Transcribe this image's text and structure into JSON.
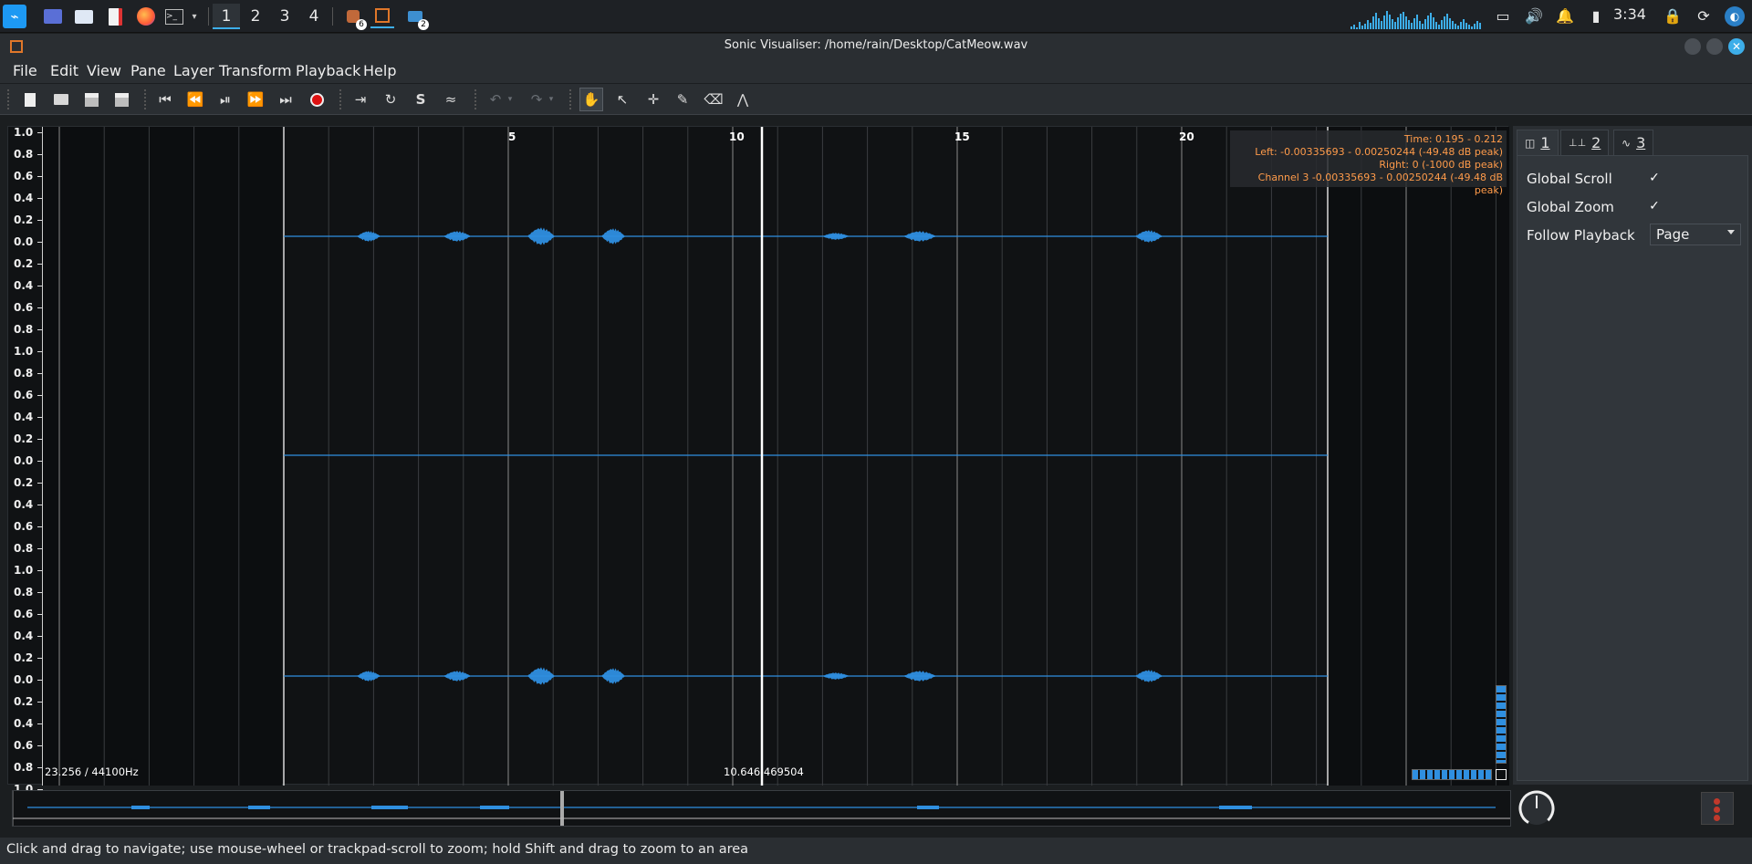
{
  "taskbar": {
    "virtual_desktops": [
      "1",
      "2",
      "3",
      "4"
    ],
    "badges": {
      "app1": "6",
      "app3": "2"
    },
    "clock": "3:34"
  },
  "window": {
    "title": "Sonic Visualiser: /home/rain/Desktop/CatMeow.wav"
  },
  "menu": [
    "File",
    "Edit",
    "View",
    "Pane",
    "Layer",
    "Transform",
    "Playback",
    "Help"
  ],
  "toolbar": {
    "icons": [
      "new-icon",
      "open-icon",
      "save-icon",
      "save-as-icon",
      "rewind-start-icon",
      "rewind-icon",
      "play-pause-icon",
      "fast-forward-icon",
      "fast-forward-end-icon",
      "record-icon",
      "play-selection-icon",
      "loop-icon",
      "solo-icon",
      "speed-icon",
      "undo-icon",
      "redo-icon",
      "navigate-icon",
      "select-icon",
      "edit-icon",
      "draw-icon",
      "erase-icon",
      "measure-icon"
    ]
  },
  "pane": {
    "scale_labels": [
      "1.0",
      "0.8",
      "0.6",
      "0.4",
      "0.2",
      "0.0",
      "0.2",
      "0.4",
      "0.6",
      "0.8",
      "1.0",
      "0.8",
      "0.6",
      "0.4",
      "0.2",
      "0.0",
      "0.2",
      "0.4",
      "0.6",
      "0.8",
      "1.0",
      "0.8",
      "0.6",
      "0.4",
      "0.2",
      "0.0",
      "0.2",
      "0.4",
      "0.6",
      "0.8",
      "1.0"
    ],
    "time_ruler": [
      "5",
      "10",
      "15",
      "20"
    ],
    "info": {
      "time": "Time: 0.195 - 0.212",
      "left": "Left: -0.00335693 - 0.00250244 (-49.48 dB peak)",
      "right": "Right: 0 (-1000 dB peak)",
      "channel3": "Channel 3 -0.00335693 - 0.00250244 (-49.48 dB peak)"
    },
    "sample_rate": "23.256 / 44100Hz",
    "cursor_time": "10.646 469504",
    "colors": {
      "waveform": "#2f8fe0",
      "info_text": "#ff9b4a",
      "background": "#101214"
    }
  },
  "properties": {
    "tabs": [
      "1",
      "2",
      "3"
    ],
    "global_scroll": {
      "label": "Global Scroll",
      "checked": "✓"
    },
    "global_zoom": {
      "label": "Global Zoom",
      "checked": "✓"
    },
    "follow_playback": {
      "label": "Follow Playback",
      "value": "Page"
    }
  },
  "status": "Click and drag to navigate; use mouse-wheel or trackpad-scroll to zoom; hold Shift and drag to zoom to an area"
}
